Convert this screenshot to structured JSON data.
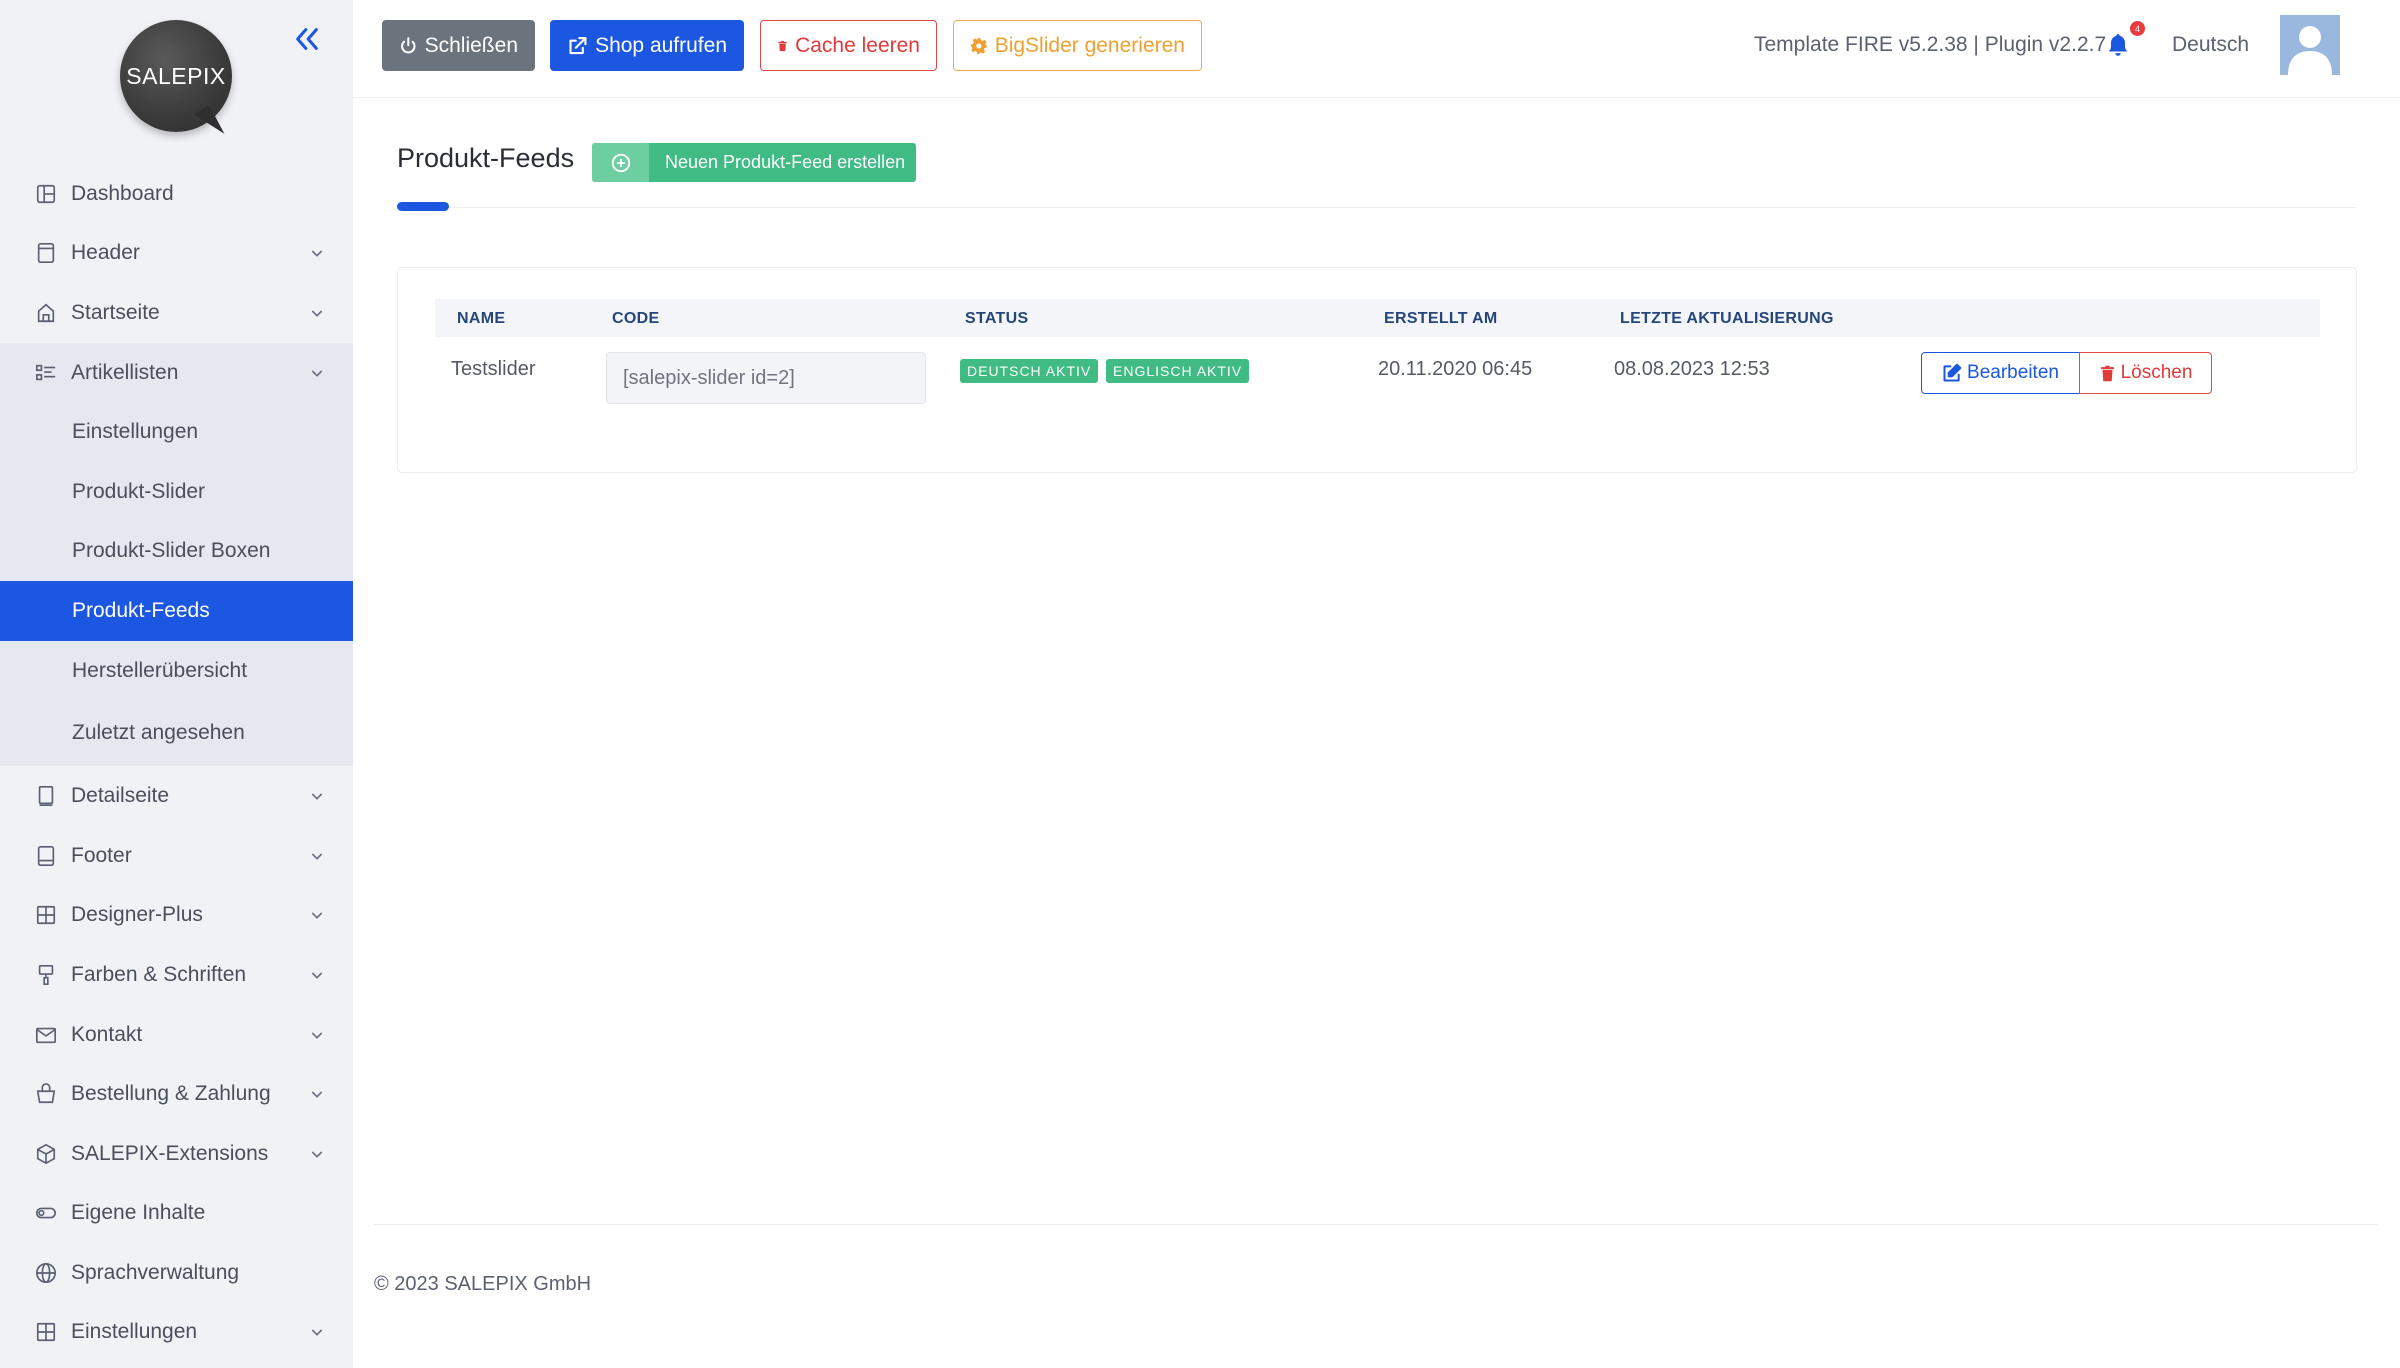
{
  "brand": {
    "logo_text": "SALEPIX"
  },
  "sidebar": {
    "items": [
      {
        "label": "Dashboard",
        "icon": "dashboard-icon"
      },
      {
        "label": "Header",
        "icon": "header-icon"
      },
      {
        "label": "Startseite",
        "icon": "home-icon"
      },
      {
        "label": "Artikellisten",
        "icon": "list-icon",
        "children": [
          "Einstellungen",
          "Produkt-Slider",
          "Produkt-Slider Boxen",
          "Produkt-Feeds",
          "Herstellerübersicht",
          "Zuletzt angesehen"
        ],
        "active_child": "Produkt-Feeds"
      },
      {
        "label": "Detailseite",
        "icon": "book-icon"
      },
      {
        "label": "Footer",
        "icon": "footer-icon"
      },
      {
        "label": "Designer-Plus",
        "icon": "grid-icon"
      },
      {
        "label": "Farben & Schriften",
        "icon": "paint-icon"
      },
      {
        "label": "Kontakt",
        "icon": "mail-icon"
      },
      {
        "label": "Bestellung & Zahlung",
        "icon": "basket-icon"
      },
      {
        "label": "SALEPIX-Extensions",
        "icon": "box-icon"
      },
      {
        "label": "Eigene Inhalte",
        "icon": "toggle-icon"
      },
      {
        "label": "Sprachverwaltung",
        "icon": "globe-icon"
      },
      {
        "label": "Einstellungen",
        "icon": "settings-grid-icon"
      }
    ]
  },
  "topbar": {
    "close_label": "Schließen",
    "shop_label": "Shop aufrufen",
    "cache_label": "Cache leeren",
    "slider_label": "BigSlider generieren",
    "version": "Template FIRE v5.2.38 | Plugin v2.2.7",
    "notification_count": "4",
    "language": "Deutsch"
  },
  "main": {
    "title": "Produkt-Feeds",
    "new_button": "Neuen Produkt-Feed erstellen",
    "table": {
      "headers": [
        "NAME",
        "CODE",
        "STATUS",
        "ERSTELLT AM",
        "LETZTE AKTUALISIERUNG"
      ],
      "rows": [
        {
          "name": "Testslider",
          "code": "[salepix-slider id=2]",
          "status": [
            "DEUTSCH AKTIV",
            "ENGLISCH AKTIV"
          ],
          "created": "20.11.2020 06:45",
          "updated": "08.08.2023 12:53",
          "edit_label": "Bearbeiten",
          "delete_label": "Löschen"
        }
      ]
    }
  },
  "footer": {
    "copyright": "© 2023 SALEPIX GmbH"
  },
  "colors": {
    "primary": "#1b57e0",
    "success": "#3fbb83",
    "danger": "#e03a3a",
    "warning": "#f0a030",
    "sidebar_bg": "#f1f2f6"
  }
}
